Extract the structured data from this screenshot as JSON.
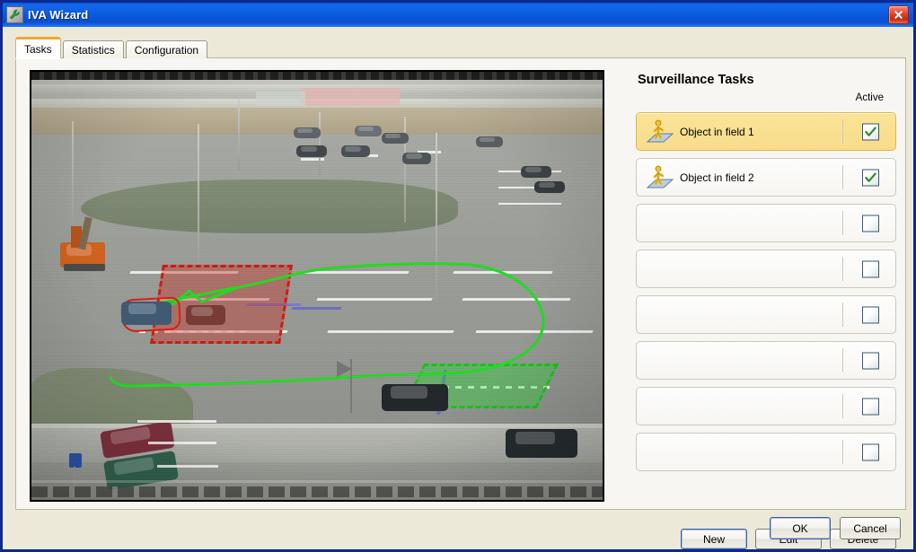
{
  "window": {
    "title": "IVA Wizard",
    "icon": "wrench-icon",
    "close_label": "✕"
  },
  "tabs": [
    {
      "id": "tasks",
      "label": "Tasks",
      "active": true
    },
    {
      "id": "statistics",
      "label": "Statistics",
      "active": false
    },
    {
      "id": "configuration",
      "label": "Configuration",
      "active": false
    }
  ],
  "video": {
    "name": "surveillance-video-preview",
    "description": "CCTV parking lot view with detection fields and object trajectory",
    "overlays": [
      {
        "type": "detection-field",
        "color": "#d11a10",
        "label": "Object in field 1 zone"
      },
      {
        "type": "detection-field",
        "color": "#17c51a",
        "label": "Object in field 2 zone"
      },
      {
        "type": "trajectory",
        "color": "#22dd22"
      },
      {
        "type": "object-outline",
        "color": "#e01b0e"
      }
    ]
  },
  "tasks_panel": {
    "title": "Surveillance Tasks",
    "active_column_header": "Active",
    "rows": [
      {
        "label": "Object in field 1",
        "icon": "object-in-field-icon",
        "checked": true,
        "selected": true
      },
      {
        "label": "Object in field 2",
        "icon": "object-in-field-icon",
        "checked": true,
        "selected": false
      },
      {
        "label": "",
        "icon": "",
        "checked": false,
        "selected": false
      },
      {
        "label": "",
        "icon": "",
        "checked": false,
        "selected": false
      },
      {
        "label": "",
        "icon": "",
        "checked": false,
        "selected": false
      },
      {
        "label": "",
        "icon": "",
        "checked": false,
        "selected": false
      },
      {
        "label": "",
        "icon": "",
        "checked": false,
        "selected": false
      },
      {
        "label": "",
        "icon": "",
        "checked": false,
        "selected": false
      }
    ],
    "buttons": {
      "new": "New",
      "edit": "Edit",
      "delete": "Delete"
    }
  },
  "dialog_buttons": {
    "ok": "OK",
    "cancel": "Cancel"
  },
  "colors": {
    "titlebar_blue": "#0b5ce0",
    "dialog_bg": "#ece9d8",
    "panel_bg": "#f7f6f2",
    "selected_row": "#f9df93",
    "accent_tab": "#f0a828",
    "check_green": "#2e8b31",
    "zone_red": "#d11a10",
    "zone_green": "#17c51a"
  }
}
